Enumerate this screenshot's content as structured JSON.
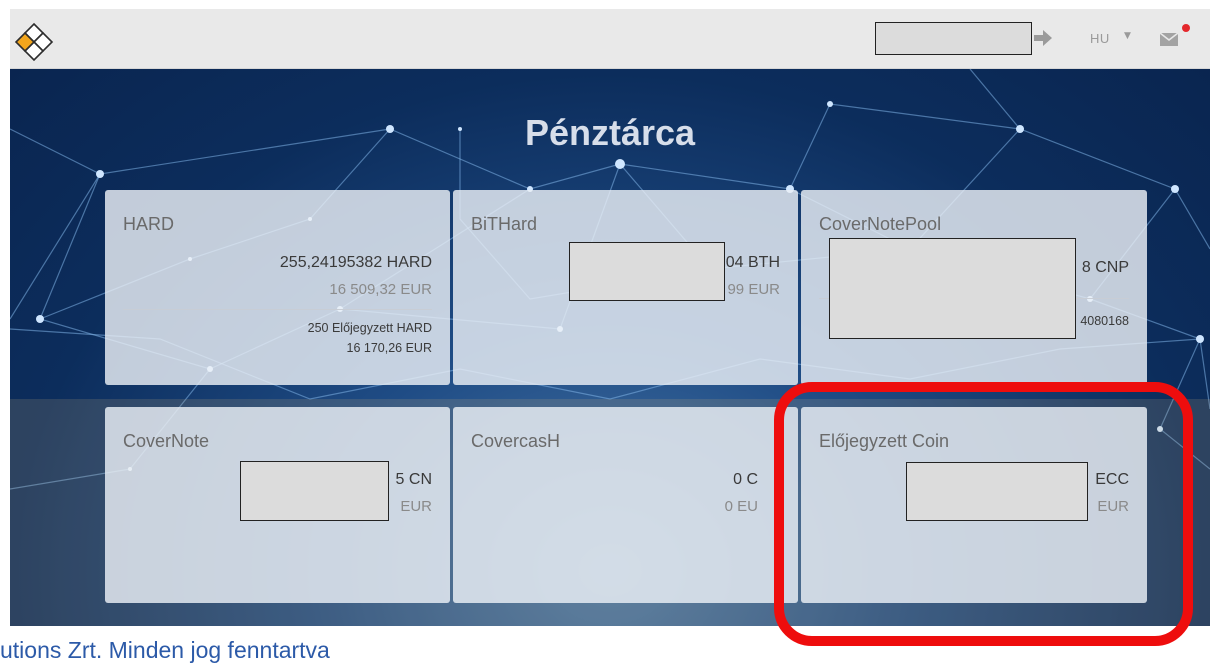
{
  "header": {
    "lang": "HU",
    "colors": {
      "bar": "#e9e9e9",
      "logo_orange": "#f2a51c",
      "notif_dot": "#e4282c"
    }
  },
  "page": {
    "title": "Pénztárca"
  },
  "wallets": {
    "hard": {
      "name": "HARD",
      "amount": "255,24195382 HARD",
      "eur": "16 509,32 EUR",
      "reserved": "250 Előjegyzett HARD",
      "reserved_eur": "16 170,26 EUR"
    },
    "bithard": {
      "name": "BiTHard",
      "amount_partial": "04 BTH",
      "eur_partial": "99 EUR"
    },
    "covernotepool": {
      "name": "CoverNotePool",
      "amount_partial": "8 CNP",
      "extra_partial": "4080168"
    },
    "covernote": {
      "name": "CoverNote",
      "amount_partial": "5 CN",
      "eur_partial": "EUR"
    },
    "covercash": {
      "name": "CovercasH",
      "amount_partial": "0 C",
      "eur_partial": "0 EU"
    },
    "reserved_coin": {
      "name": "Előjegyzett Coin",
      "amount_partial": "ECC",
      "eur_partial": "EUR"
    }
  },
  "footer": {
    "text": "utions Zrt. Minden jog fenntartva"
  },
  "annotation": {
    "color": "#ee0d0d"
  }
}
